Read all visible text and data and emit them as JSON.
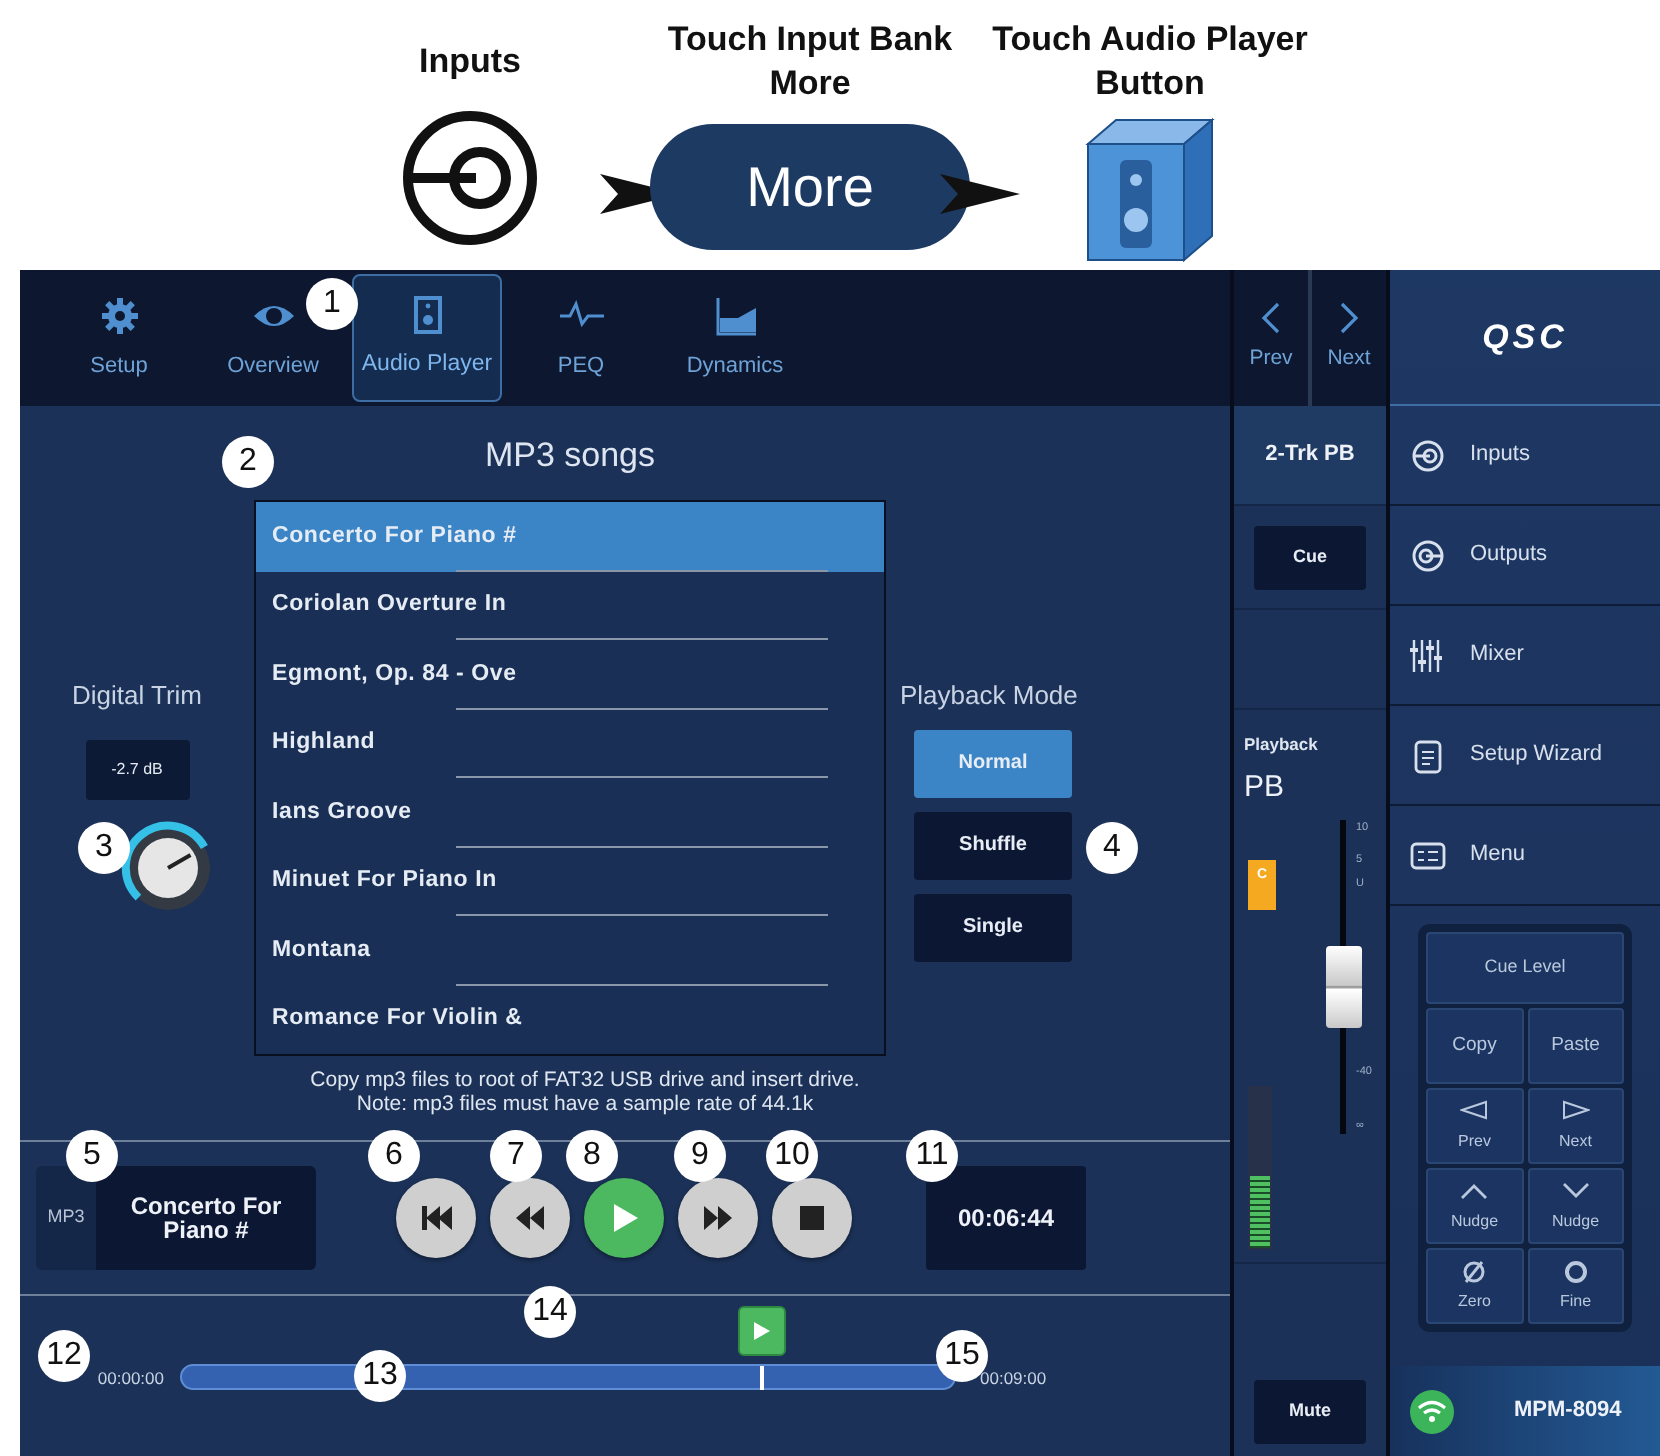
{
  "steps": [
    {
      "kind": "icon",
      "title": "Inputs"
    },
    {
      "kind": "pill",
      "title": "Touch Input Bank More",
      "button": "More"
    },
    {
      "kind": "cube",
      "title": "Touch Audio Player Button"
    }
  ],
  "tabs": [
    {
      "label": "Setup",
      "selected": false
    },
    {
      "label": "Overview",
      "selected": false
    },
    {
      "label": "Audio Player",
      "selected": true
    },
    {
      "label": "PEQ",
      "selected": false
    },
    {
      "label": "Dynamics",
      "selected": false
    }
  ],
  "song_list": {
    "title": "MP3 songs",
    "songs": [
      {
        "name": "Concerto For Piano #",
        "selected": true
      },
      {
        "name": "Coriolan Overture In",
        "selected": false
      },
      {
        "name": "Egmont, Op. 84 - Ove",
        "selected": false
      },
      {
        "name": "Highland",
        "selected": false
      },
      {
        "name": "Ians Groove",
        "selected": false
      },
      {
        "name": "Minuet For Piano In",
        "selected": false
      },
      {
        "name": "Montana",
        "selected": false
      },
      {
        "name": "Romance For Violin &",
        "selected": false
      }
    ]
  },
  "digital_trim": {
    "label": "Digital Trim",
    "value": "-2.7 dB"
  },
  "playback_mode": {
    "label": "Playback Mode",
    "options": [
      {
        "label": "Normal",
        "selected": true
      },
      {
        "label": "Shuffle",
        "selected": false
      },
      {
        "label": "Single",
        "selected": false
      }
    ]
  },
  "note_lines": [
    "Copy mp3 files to root of FAT32 USB drive and insert drive.",
    "Note: mp3 files must have a sample rate of 44.1k"
  ],
  "now_playing": {
    "format": "MP3",
    "title": "Concerto For Piano #"
  },
  "transport": [
    {
      "kind": "skip-back",
      "active": false
    },
    {
      "kind": "rewind",
      "active": false
    },
    {
      "kind": "play",
      "active": true
    },
    {
      "kind": "fast-forward",
      "active": false
    },
    {
      "kind": "stop",
      "active": false
    }
  ],
  "elapsed": "00:06:44",
  "timeline": {
    "start": "00:00:00",
    "end": "00:09:00",
    "level": 0.75
  },
  "callouts": [
    "1",
    "2",
    "3",
    "4",
    "5",
    "6",
    "7",
    "8",
    "9",
    "10",
    "11",
    "12",
    "13",
    "14",
    "15"
  ],
  "channel": {
    "prev": "Prev",
    "next": "Next",
    "name": "2-Trk PB",
    "cue": "Cue",
    "section": "Playback",
    "short_name": "PB",
    "badge": "C",
    "scale": [
      "10",
      "5",
      "U",
      "-40",
      "∞"
    ],
    "fader": {
      "level": 0.47
    },
    "meter": {
      "level": 0.45
    },
    "mute": "Mute"
  },
  "nav": {
    "logo": "QSC",
    "items": [
      "Inputs",
      "Outputs",
      "Mixer",
      "Setup Wizard",
      "Menu"
    ]
  },
  "keypad": [
    {
      "kind": "wide",
      "label": "Cue Level"
    },
    {
      "kind": "text",
      "label": "Copy"
    },
    {
      "kind": "text",
      "label": "Paste"
    },
    {
      "kind": "icon",
      "label": "Prev"
    },
    {
      "kind": "icon",
      "label": "Next"
    },
    {
      "kind": "icon",
      "label": "Nudge"
    },
    {
      "kind": "icon",
      "label": "Nudge"
    },
    {
      "kind": "icon",
      "label": "Zero"
    },
    {
      "kind": "icon",
      "label": "Fine"
    }
  ],
  "device": {
    "name": "MPM-8094"
  }
}
